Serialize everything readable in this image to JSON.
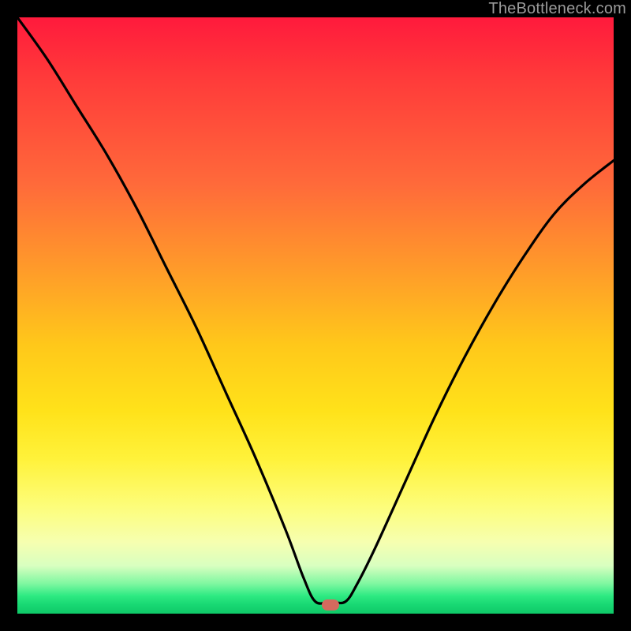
{
  "watermark": "TheBottleneck.com",
  "marker": {
    "x_frac": 0.525,
    "y_frac": 0.985
  },
  "chart_data": {
    "type": "line",
    "title": "",
    "xlabel": "",
    "ylabel": "",
    "xlim": [
      0,
      1
    ],
    "ylim": [
      0,
      1
    ],
    "series": [
      {
        "name": "bottleneck-curve",
        "x": [
          0.0,
          0.05,
          0.1,
          0.15,
          0.2,
          0.25,
          0.3,
          0.35,
          0.4,
          0.45,
          0.48,
          0.5,
          0.525,
          0.55,
          0.57,
          0.6,
          0.65,
          0.7,
          0.75,
          0.8,
          0.85,
          0.9,
          0.95,
          1.0
        ],
        "y": [
          1.0,
          0.93,
          0.85,
          0.77,
          0.68,
          0.58,
          0.48,
          0.37,
          0.26,
          0.14,
          0.06,
          0.02,
          0.02,
          0.02,
          0.05,
          0.11,
          0.22,
          0.33,
          0.43,
          0.52,
          0.6,
          0.67,
          0.72,
          0.76
        ]
      }
    ],
    "background_gradient": {
      "type": "vertical",
      "stops": [
        {
          "pos": 0.0,
          "color": "#ff1a3c"
        },
        {
          "pos": 0.28,
          "color": "#ff6a3a"
        },
        {
          "pos": 0.55,
          "color": "#ffc81a"
        },
        {
          "pos": 0.74,
          "color": "#fff23a"
        },
        {
          "pos": 0.92,
          "color": "#d8ffc0"
        },
        {
          "pos": 1.0,
          "color": "#0fc868"
        }
      ]
    },
    "marker": {
      "x": 0.525,
      "y": 0.015,
      "color": "#d46a5e"
    }
  }
}
